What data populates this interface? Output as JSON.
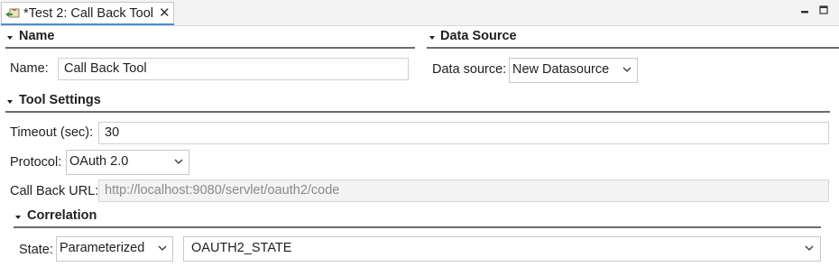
{
  "tab": {
    "title": "*Test 2: Call Back Tool",
    "icon": "test-editor-icon",
    "close_symbol": "✕"
  },
  "window_controls": {
    "minimize_icon": "minimize-icon",
    "maximize_icon": "maximize-icon"
  },
  "sections": {
    "name": {
      "title": "Name"
    },
    "data_source": {
      "title": "Data Source"
    },
    "tool_settings": {
      "title": "Tool Settings"
    },
    "correlation": {
      "title": "Correlation"
    }
  },
  "name_section": {
    "label": "Name:",
    "value": "Call Back Tool"
  },
  "data_source_section": {
    "label": "Data source:",
    "value": "New Datasource"
  },
  "tool_settings": {
    "timeout_label": "Timeout (sec):",
    "timeout_value": "30",
    "protocol_label": "Protocol:",
    "protocol_value": "OAuth 2.0",
    "callback_label": "Call Back URL:",
    "callback_value": "http://localhost:9080/servlet/oauth2/code"
  },
  "correlation": {
    "state_label": "State:",
    "state_mode": "Parameterized",
    "state_value": "OAUTH2_STATE"
  },
  "colors": {
    "tab_accent": "#4b8cd1",
    "section_line": "#6b6b6b",
    "disabled_text": "#8a8a8a"
  }
}
